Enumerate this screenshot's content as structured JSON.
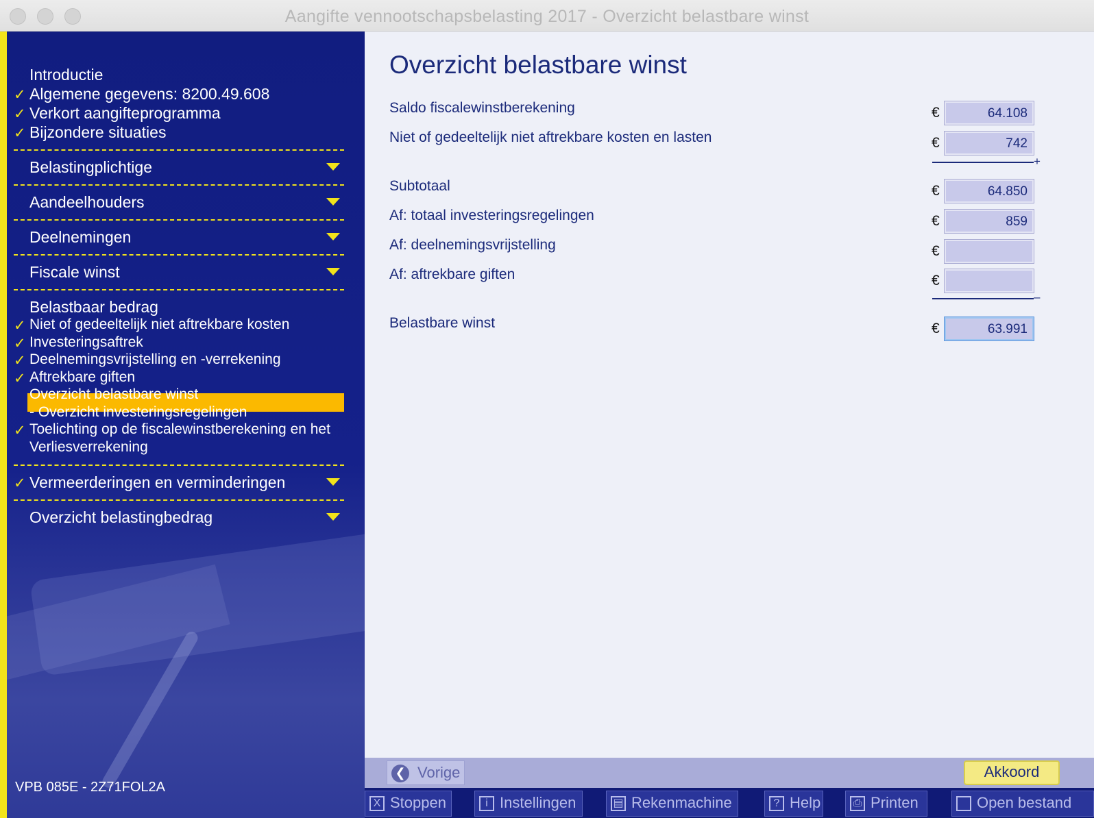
{
  "window": {
    "title": "Aangifte vennootschapsbelasting 2017 - Overzicht belastbare winst"
  },
  "sidebar": {
    "items": [
      {
        "label": "Introductie",
        "checked": false
      },
      {
        "label": "Algemene gegevens: 8200.49.608",
        "checked": true
      },
      {
        "label": "Verkort aangifteprogramma",
        "checked": true
      },
      {
        "label": "Bijzondere situaties",
        "checked": true
      },
      {
        "label": "Belastingplichtige",
        "checked": false
      },
      {
        "label": "Aandeelhouders",
        "checked": false
      },
      {
        "label": "Deelnemingen",
        "checked": false
      },
      {
        "label": "Fiscale winst",
        "checked": false
      },
      {
        "label": "Belastbaar bedrag",
        "checked": false
      },
      {
        "label": "Niet of gedeeltelijk niet aftrekbare kosten",
        "checked": true
      },
      {
        "label": "Investeringsaftrek",
        "checked": true
      },
      {
        "label": "Deelnemingsvrijstelling en -verrekening",
        "checked": true
      },
      {
        "label": "Aftrekbare giften",
        "checked": true
      },
      {
        "label": "Overzicht belastbare winst",
        "checked": false,
        "active": true
      },
      {
        "label": "- Overzicht investeringsregelingen",
        "checked": false
      },
      {
        "label": "Toelichting op de fiscalewinstberekening en het",
        "checked": true
      },
      {
        "label": "Verliesverrekening",
        "checked": false
      },
      {
        "label": "Vermeerderingen en verminderingen",
        "checked": true
      },
      {
        "label": "Overzicht belastingbedrag",
        "checked": false
      }
    ],
    "check_glyph": "✓",
    "footer_code": "VPB 085E - 2Z71FOL2A"
  },
  "main": {
    "heading": "Overzicht belastbare winst",
    "currency": "€",
    "rows": [
      {
        "label": "Saldo fiscalewinstberekening",
        "value": "64.108"
      },
      {
        "label": "Niet of gedeeltelijk niet aftrekbare kosten en lasten",
        "value": "742"
      },
      {
        "label": "Subtotaal",
        "value": "64.850"
      },
      {
        "label": "Af: totaal investeringsregelingen",
        "value": "859"
      },
      {
        "label": "Af: deelnemingsvrijstelling",
        "value": ""
      },
      {
        "label": "Af: aftrekbare giften",
        "value": ""
      },
      {
        "label": "Belastbare winst",
        "value": "63.991"
      }
    ],
    "plus_sign": "+",
    "minus_sign": "–"
  },
  "navigation": {
    "prev_label": "Vorige",
    "ok_label": "Akkoord"
  },
  "toolbar": {
    "buttons": [
      {
        "label": "Stoppen",
        "icon": "close-box-icon",
        "glyph": "X"
      },
      {
        "label": "Instellingen",
        "icon": "info-icon",
        "glyph": "i"
      },
      {
        "label": "Rekenmachine",
        "icon": "calculator-icon",
        "glyph": "▤"
      },
      {
        "label": "Help",
        "icon": "help-icon",
        "glyph": "?"
      },
      {
        "label": "Printen",
        "icon": "printer-icon",
        "glyph": "⎙"
      },
      {
        "label": "Open bestand",
        "icon": "folder-icon",
        "glyph": ""
      }
    ]
  },
  "colors": {
    "sidebar_bg": "#111d80",
    "accent_yellow": "#f2e31b",
    "active_item": "#fbb900",
    "main_bg": "#eef0f8",
    "field_bg": "#c8c9ea",
    "text_navy": "#1b2a7a"
  }
}
